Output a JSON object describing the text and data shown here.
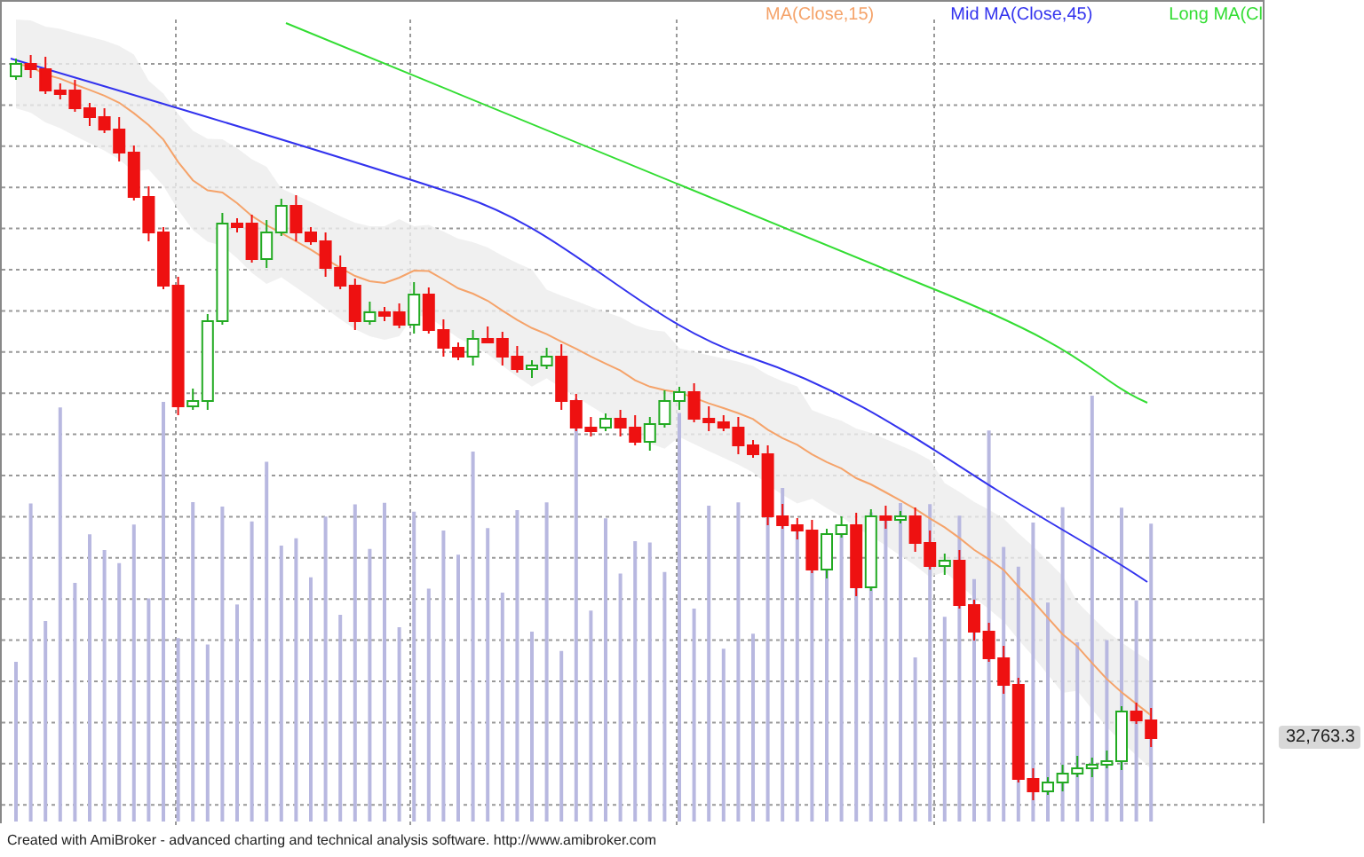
{
  "legend": [
    {
      "text": "MA(Close,15)",
      "color": "#f5a36a"
    },
    {
      "text": "Mid MA(Close,45)",
      "color": "#3333ee"
    },
    {
      "text": "Long MA(Cl",
      "color": "#33dd33"
    }
  ],
  "price_label": "32,763.3",
  "footer": "Created with AmiBroker - advanced charting and technical analysis software. http://www.amibroker.com"
}
